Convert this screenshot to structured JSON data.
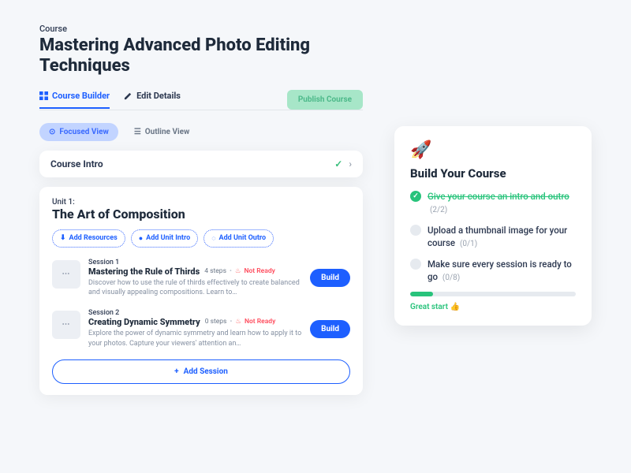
{
  "breadcrumb": "Course",
  "title": "Mastering Advanced Photo Editing Techniques",
  "tabs": {
    "builder": "Course Builder",
    "edit": "Edit Details"
  },
  "publish": "Publish Course",
  "views": {
    "focused": "Focused View",
    "outline": "Outline View"
  },
  "intro": {
    "label": "Course Intro"
  },
  "unit": {
    "label": "Unit 1:",
    "title": "The Art of Composition",
    "chips": {
      "resources": "Add Resources",
      "intro": "Add Unit Intro",
      "outro": "Add Unit Outro"
    }
  },
  "sessions": [
    {
      "label": "Session 1",
      "title": "Mastering the Rule of Thirds",
      "steps": "4 steps",
      "status": "Not Ready",
      "desc": "Discover how to use the rule of thirds effectively to create balanced and visually appealing compositions. Learn to…",
      "build": "Build"
    },
    {
      "label": "Session 2",
      "title": "Creating Dynamic Symmetry",
      "steps": "0 steps",
      "status": "Not Ready",
      "desc": "Explore the power of dynamic symmetry and learn how to apply it to your photos. Capture your viewers' attention an…",
      "build": "Build"
    }
  ],
  "add_session": "Add Session",
  "sidebar": {
    "title": "Build Your Course",
    "tasks": [
      {
        "text": "Give your course an intro and outro",
        "count": "(2/2)",
        "done": true
      },
      {
        "text": "Upload a thumbnail image for your course",
        "count": "(0/1)",
        "done": false
      },
      {
        "text": "Make sure every session is ready to go",
        "count": "(0/8)",
        "done": false
      }
    ],
    "progress_label": "Great start 👍"
  }
}
